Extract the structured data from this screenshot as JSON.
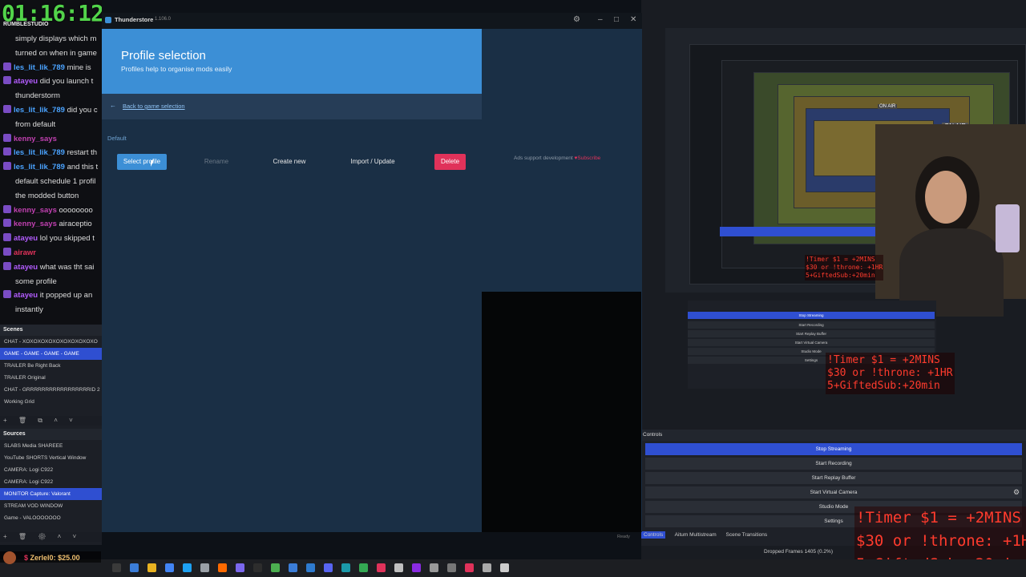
{
  "stream": {
    "timer": "01:16:12",
    "channel_tag": "RUMBLESTUDIO"
  },
  "chat": {
    "messages": [
      {
        "user": "",
        "text": "simply displays which m",
        "color": "#ddd"
      },
      {
        "user": "",
        "text": "turned on when in game",
        "color": "#ddd"
      },
      {
        "user": "les_lit_lik_789",
        "text": "mine is",
        "color": "#4aa3ff"
      },
      {
        "user": "atayeu",
        "text": "did you launch t",
        "color": "#b35cff"
      },
      {
        "user": "",
        "text": "thunderstorm",
        "color": "#ddd"
      },
      {
        "user": "les_lit_lik_789",
        "text": "did you c",
        "color": "#4aa3ff"
      },
      {
        "user": "",
        "text": "from default",
        "color": "#ddd"
      },
      {
        "user": "kenny_says",
        "text": "",
        "color": "#c040b0"
      },
      {
        "user": "les_lit_lik_789",
        "text": "restart th",
        "color": "#4aa3ff"
      },
      {
        "user": "les_lit_lik_789",
        "text": "and this t",
        "color": "#4aa3ff"
      },
      {
        "user": "",
        "text": "default schedule 1 profil",
        "color": "#ddd"
      },
      {
        "user": "",
        "text": "the modded button",
        "color": "#ddd"
      },
      {
        "user": "kenny_says",
        "text": "oooooooo",
        "color": "#c040b0"
      },
      {
        "user": "kenny_says",
        "text": "airaceptio",
        "color": "#c040b0"
      },
      {
        "user": "atayeu",
        "text": "lol you skipped t",
        "color": "#b35cff"
      },
      {
        "user": "airawr",
        "text": "",
        "color": "#e0325a"
      },
      {
        "user": "atayeu",
        "text": "what was tht sai",
        "color": "#b35cff"
      },
      {
        "user": "",
        "text": "some profile",
        "color": "#ddd"
      },
      {
        "user": "atayeu",
        "text": "it popped up an",
        "color": "#b35cff"
      },
      {
        "user": "",
        "text": "instantly",
        "color": "#ddd"
      }
    ]
  },
  "scenes": {
    "title": "Scenes",
    "items": [
      {
        "label": "CHAT - XOXOXOXOXOXOXOXOXOXO",
        "selected": false
      },
      {
        "label": "GAME - GAME - GAME - GAME",
        "selected": true
      },
      {
        "label": "TRAILER Be Right Back",
        "selected": false
      },
      {
        "label": "TRAILER Original",
        "selected": false
      },
      {
        "label": "CHAT - GRRRRRRRRRRRRRRRRRID 2",
        "selected": false
      },
      {
        "label": "Working Grid",
        "selected": false
      }
    ],
    "toolbar": "+ 🗑 ⧉ ˄ ˅"
  },
  "sources": {
    "title": "Sources",
    "items": [
      {
        "label": "SLABS Media SHAREEE",
        "selected": false
      },
      {
        "label": "YouTube SHORTS Vertical Window",
        "selected": false
      },
      {
        "label": "CAMERA: Logi C922",
        "selected": false
      },
      {
        "label": "CAMERA: Logi C922",
        "selected": false
      },
      {
        "label": "MONITOR Capture: Valorant",
        "selected": true
      },
      {
        "label": "STREAM VOD WINDOW",
        "selected": false
      },
      {
        "label": "Game - VALOOOOOOO",
        "selected": false
      }
    ],
    "toolbar": "+ 🗑 ⚙ ˄ ˅"
  },
  "app": {
    "title": "Thunderstore",
    "version": "1.106.0",
    "header_title": "Profile selection",
    "header_subtitle": "Profiles help to organise mods easily",
    "back_link": "Back to game selection",
    "profile_name": "Default",
    "buttons": {
      "select": "Select profile",
      "rename": "Rename",
      "create": "Create new",
      "import": "Import / Update",
      "delete": "Delete"
    },
    "ads_text": "Ads support development",
    "subscribe": "Subscribe",
    "status": "Ready"
  },
  "obs": {
    "controls_title": "Controls",
    "controls": [
      {
        "label": "Stop Streaming",
        "active": true
      },
      {
        "label": "Start Recording",
        "active": false
      },
      {
        "label": "Start Replay Buffer",
        "active": false
      },
      {
        "label": "Start Virtual Camera",
        "active": false
      },
      {
        "label": "Studio Mode",
        "active": false
      },
      {
        "label": "Settings",
        "active": false
      }
    ],
    "tabs": [
      "Controls",
      "Aitum Multistream",
      "Scene Transitions"
    ],
    "dropped_frames": "Dropped Frames 1405 (0.2%)",
    "on_air": "ON AIR"
  },
  "overlay": {
    "line1": "!Timer $1 = +2MINS",
    "line2": "$30 or !throne: +1HR",
    "line3": "5+GiftedSub:+20min"
  },
  "donation": {
    "user": "Zerlel0",
    "amount": "$25.00"
  }
}
